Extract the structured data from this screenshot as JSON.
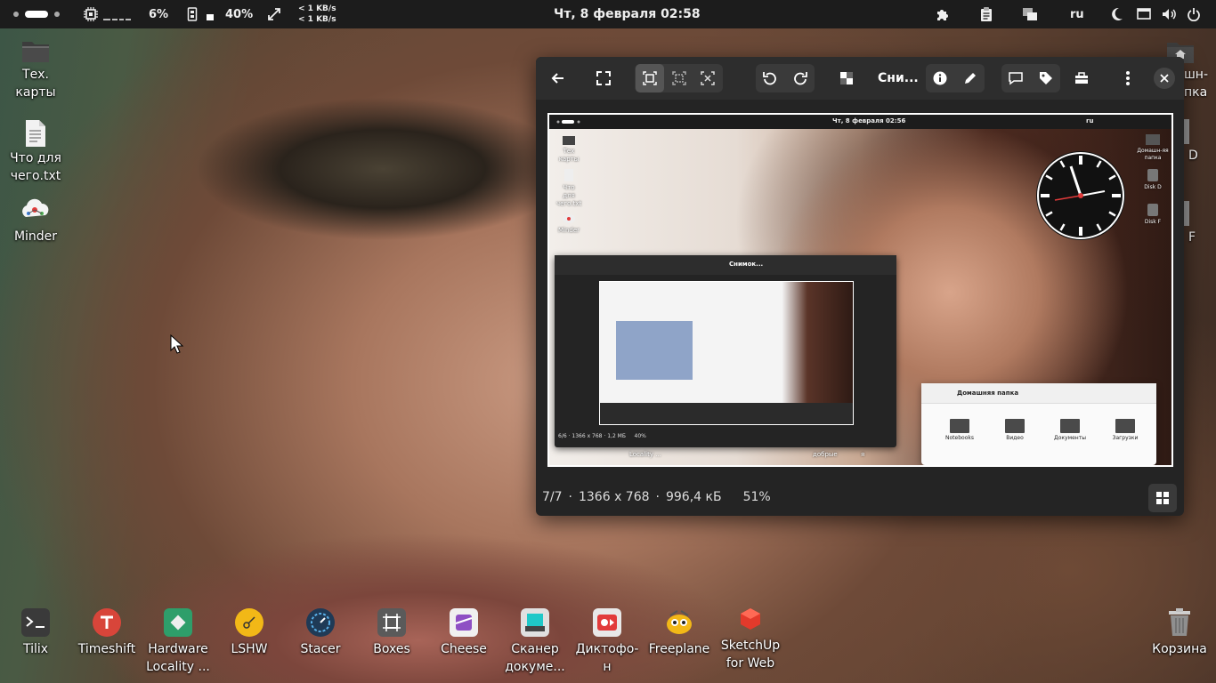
{
  "top_panel": {
    "cpu_percent": "6%",
    "mem_percent": "40%",
    "net_down": "< 1 KB/s",
    "net_up": "< 1 KB/s",
    "datetime": "Чт, 8 февраля  02:58",
    "keyboard_layout": "ru"
  },
  "desktop_icons": [
    {
      "label_1": "Тех.",
      "label_2": "карты"
    },
    {
      "label_1": "Что для",
      "label_2": "чего.txt"
    },
    {
      "label_1": "Minder",
      "label_2": ""
    }
  ],
  "right_partial": {
    "label_1": "шн-",
    "label_2": "пка",
    "d": "D",
    "f": "F"
  },
  "dock": [
    {
      "label_1": "Tilix",
      "label_2": ""
    },
    {
      "label_1": "Timeshift",
      "label_2": ""
    },
    {
      "label_1": "Hardware",
      "label_2": "Locality ..."
    },
    {
      "label_1": "LSHW",
      "label_2": ""
    },
    {
      "label_1": "Stacer",
      "label_2": ""
    },
    {
      "label_1": "Boxes",
      "label_2": ""
    },
    {
      "label_1": "Cheese",
      "label_2": ""
    },
    {
      "label_1": "Сканер",
      "label_2": "докуме..."
    },
    {
      "label_1": "Диктофо-",
      "label_2": "н"
    },
    {
      "label_1": "Freeplane",
      "label_2": ""
    },
    {
      "label_1": "SketchUp",
      "label_2": "for Web"
    }
  ],
  "trash": {
    "label": "Корзина"
  },
  "viewer": {
    "title": "Сни...",
    "footer": {
      "position": "7/7",
      "dimensions": "1366 x 768",
      "size": "996,4 кБ",
      "zoom": "51%"
    },
    "screenshot": {
      "datetime": "Чт, 8 февраля  02:56",
      "layout": "ru",
      "icons": [
        "Тех карты",
        "Что для чего.txt",
        "Minder"
      ],
      "right_icons": [
        "Домашн-яя папка",
        "Disk D",
        "Disk F"
      ],
      "files_title": "Домашняя папка",
      "folders": [
        "Notebooks",
        "Видео",
        "Документы",
        "Загрузки"
      ],
      "inner_viewer_title": "Снимок...",
      "inner_footer": {
        "position": "6/6",
        "dimensions": "1366 x 768",
        "size": "1,2 МБ",
        "zoom": "40%"
      },
      "bottom_labels": [
        "Locality ...",
        "добрые",
        "я"
      ]
    }
  },
  "colors": {
    "panel": "#1c1c1c",
    "viewer_bg": "#242424",
    "accent_red": "#e23b3b"
  }
}
